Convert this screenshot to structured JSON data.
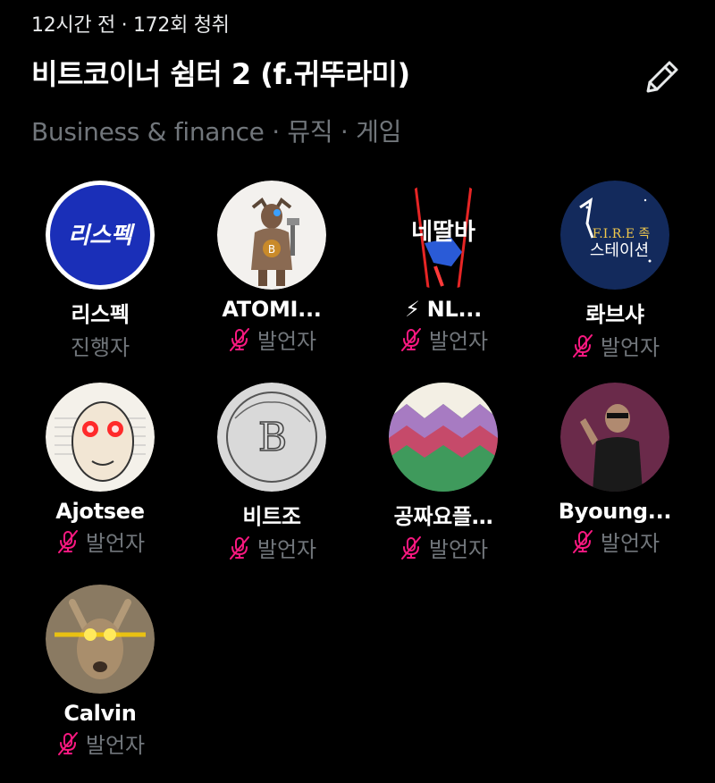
{
  "space": {
    "meta": "12시간 전 · 172회 청취",
    "title": "비트코이너 쉼터 2 (f.귀뚜라미)",
    "topics": "Business & finance · 뮤직 · 게임"
  },
  "participants": [
    {
      "name": "리스펙",
      "role": "진행자",
      "muted": false,
      "avatar_text": "리스펙"
    },
    {
      "name": "ATOMI...",
      "role": "발언자",
      "muted": true
    },
    {
      "name": "⚡ NL...",
      "role": "발언자",
      "muted": true,
      "avatar_text": "네딸바"
    },
    {
      "name": "롸브샤",
      "role": "발언자",
      "muted": true,
      "avatar_text_1": "F.I.R.E 족",
      "avatar_text_2": "스테이션"
    },
    {
      "name": "Ajotsee",
      "role": "발언자",
      "muted": true
    },
    {
      "name": "비트조",
      "role": "발언자",
      "muted": true
    },
    {
      "name": "공짜요플…",
      "role": "발언자",
      "muted": true
    },
    {
      "name": "Byoung...",
      "role": "발언자",
      "muted": true
    },
    {
      "name": "Calvin",
      "role": "발언자",
      "muted": true
    }
  ],
  "colors": {
    "background": "#000000",
    "muted_mic": "#f91880",
    "secondary_text": "#71767b",
    "respect_blue": "#1a2fb8"
  }
}
